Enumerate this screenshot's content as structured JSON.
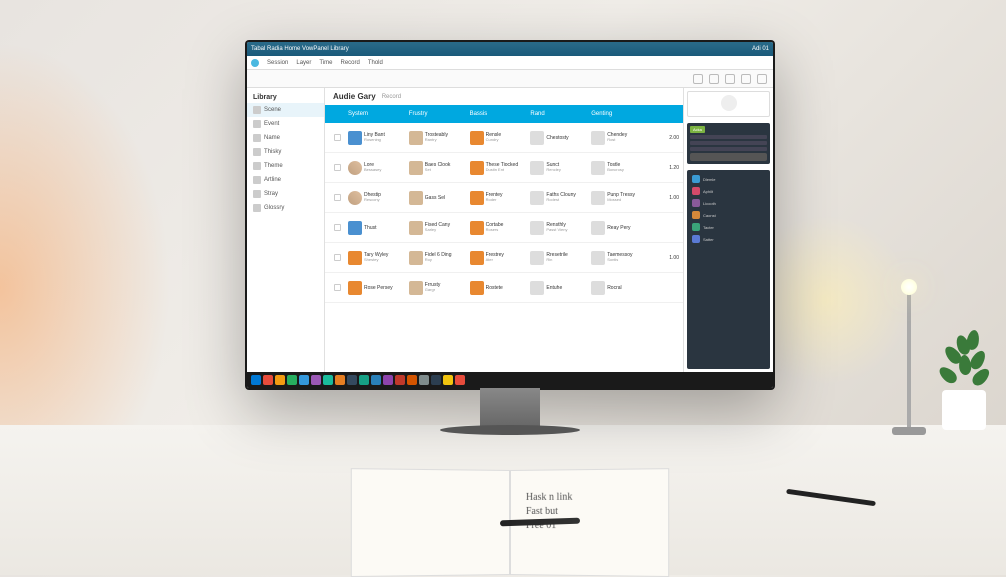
{
  "titlebar": {
    "title": "Tabal Radia Home VowPanel Library",
    "right": "Adi 01"
  },
  "menubar": {
    "items": [
      "Session",
      "Layer",
      "Time",
      "Record",
      "Thold"
    ]
  },
  "sidebar": {
    "header": "Library",
    "items": [
      {
        "label": "Scene"
      },
      {
        "label": "Event"
      },
      {
        "label": "Name"
      },
      {
        "label": "Thisky"
      },
      {
        "label": "Theme"
      },
      {
        "label": "Artline"
      },
      {
        "label": "Stray"
      },
      {
        "label": "Glossry"
      }
    ]
  },
  "main": {
    "title": "Audie Gary",
    "subtitle": "Record",
    "columns": [
      "System",
      "Frustry",
      "Bassis",
      "Rand",
      "Genting"
    ],
    "rows": [
      {
        "c1": {
          "t1": "Liny Bant",
          "t2": "Rosening"
        },
        "c2": {
          "t1": "Trosteably",
          "t2": "Rantry"
        },
        "c3": {
          "t1": "Rensle",
          "t2": "Cundry"
        },
        "c4": {
          "t1": "Chestosty",
          "t2": ""
        },
        "c5": {
          "t1": "Chendey",
          "t2": "Rost"
        },
        "val": "2.00",
        "ico": "ico-blue"
      },
      {
        "c1": {
          "t1": "Lore",
          "t2": "Bessasey"
        },
        "c2": {
          "t1": "Baes Clook",
          "t2": "Set"
        },
        "c3": {
          "t1": "These Tiocked",
          "t2": "Dustin Ent"
        },
        "c4": {
          "t1": "Sunct",
          "t2": "Rencley"
        },
        "c5": {
          "t1": "Tostle",
          "t2": "Boncrosy"
        },
        "val": "1.20",
        "ico": "ico-av"
      },
      {
        "c1": {
          "t1": "Dhestip",
          "t2": "Rescony"
        },
        "c2": {
          "t1": "Gass Sel",
          "t2": ""
        },
        "c3": {
          "t1": "Frentey",
          "t2": "Roder"
        },
        "c4": {
          "t1": "Faths Clouny",
          "t2": "Rodest"
        },
        "c5": {
          "t1": "Punp Tressy",
          "t2": "Mossed"
        },
        "val": "1.00",
        "ico": "ico-av"
      },
      {
        "c1": {
          "t1": "Thust",
          "t2": ""
        },
        "c2": {
          "t1": "Fised Cany",
          "t2": "Sarley"
        },
        "c3": {
          "t1": "Cortabe",
          "t2": "Rosers"
        },
        "c4": {
          "t1": "Rensthly",
          "t2": "Passt Vieny"
        },
        "c5": {
          "t1": "Reay Pery",
          "t2": ""
        },
        "val": "",
        "ico": "ico-blue"
      },
      {
        "c1": {
          "t1": "Tary Wyley",
          "t2": "Shestey"
        },
        "c2": {
          "t1": "Fidel 6 Ding",
          "t2": "Roy"
        },
        "c3": {
          "t1": "Frestrey",
          "t2": "Ater"
        },
        "c4": {
          "t1": "Rresetrile",
          "t2": "Rin"
        },
        "c5": {
          "t1": "Taemessoy",
          "t2": "Sontis"
        },
        "val": "1.00",
        "ico": "ico-or"
      },
      {
        "c1": {
          "t1": "Rose Persey",
          "t2": ""
        },
        "c2": {
          "t1": "Frrusty",
          "t2": "Gargr"
        },
        "c3": {
          "t1": "Rostete",
          "t2": ""
        },
        "c4": {
          "t1": "Entuhe",
          "t2": ""
        },
        "c5": {
          "t1": "Rocral",
          "t2": ""
        },
        "val": "",
        "ico": "ico-or"
      }
    ]
  },
  "rightpanel": {
    "badge": "Acka",
    "items": [
      {
        "label": "Dlemle",
        "color": "#3a9bd4"
      },
      {
        "label": "Aphilt",
        "color": "#d44a6a"
      },
      {
        "label": "Licooth",
        "color": "#8a5a9a"
      },
      {
        "label": "Caonst",
        "color": "#d4883a"
      },
      {
        "label": "Tacter",
        "color": "#3aa47a"
      },
      {
        "label": "Satter",
        "color": "#5a7ad4"
      }
    ]
  },
  "taskbar": {
    "colors": [
      "#0078d4",
      "#e74c3c",
      "#f39c12",
      "#27ae60",
      "#3498db",
      "#9b59b6",
      "#1abc9c",
      "#e67e22",
      "#34495e",
      "#16a085",
      "#2980b9",
      "#8e44ad",
      "#c0392b",
      "#d35400",
      "#7f8c8d",
      "#2c3e50",
      "#f1c40f",
      "#e74c3c"
    ]
  },
  "notebook": {
    "text": "Hask n link\nFast but\nFree 01"
  }
}
